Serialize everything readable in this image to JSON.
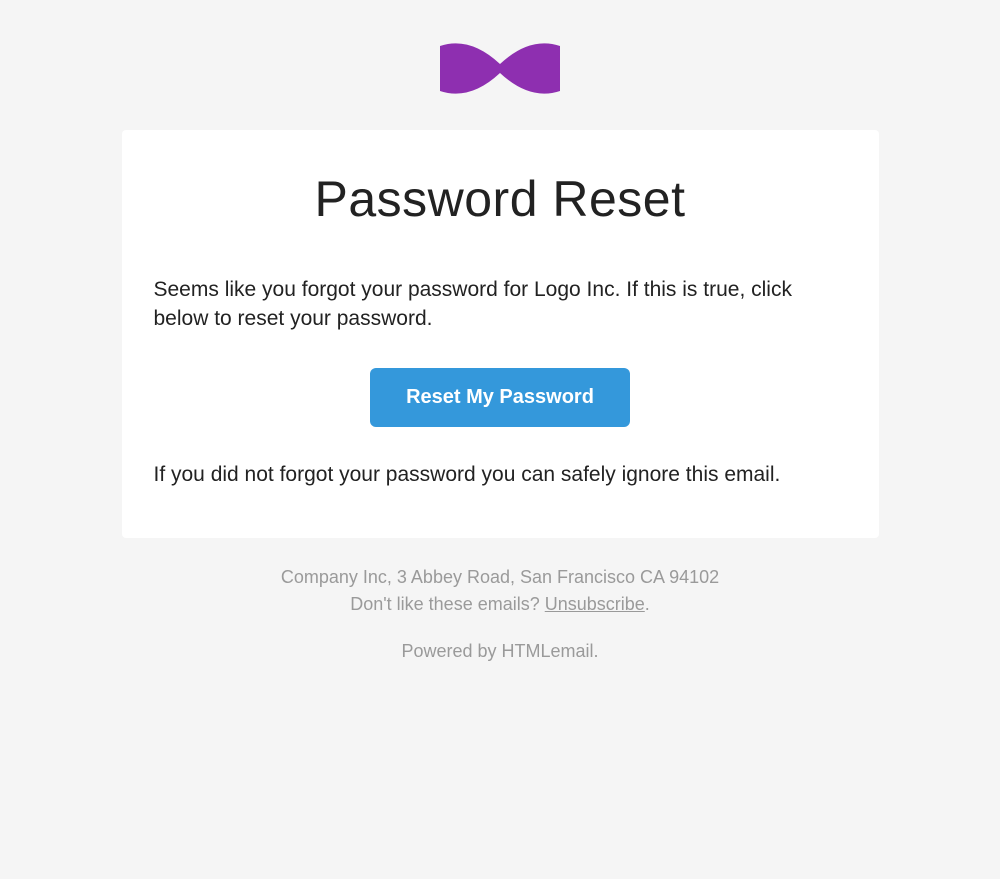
{
  "header": {
    "logo_name": "bowtie-logo"
  },
  "card": {
    "title": "Password Reset",
    "paragraph1": "Seems like you forgot your password for Logo Inc. If this is true, click below to reset your password.",
    "button_label": "Reset My Password",
    "paragraph2": "If you did not forgot your password you can safely ignore this email."
  },
  "footer": {
    "address": "Company Inc, 3 Abbey Road, San Francisco CA 94102",
    "opt_out_prefix": "Don't like these emails? ",
    "unsubscribe_label": "Unsubscribe",
    "opt_out_suffix": ".",
    "powered_by": "Powered by HTMLemail."
  },
  "colors": {
    "brand_purple": "#8e2fb0",
    "button_blue": "#3498db",
    "background_grey": "#f5f5f5",
    "footer_grey": "#9a9a9a"
  }
}
